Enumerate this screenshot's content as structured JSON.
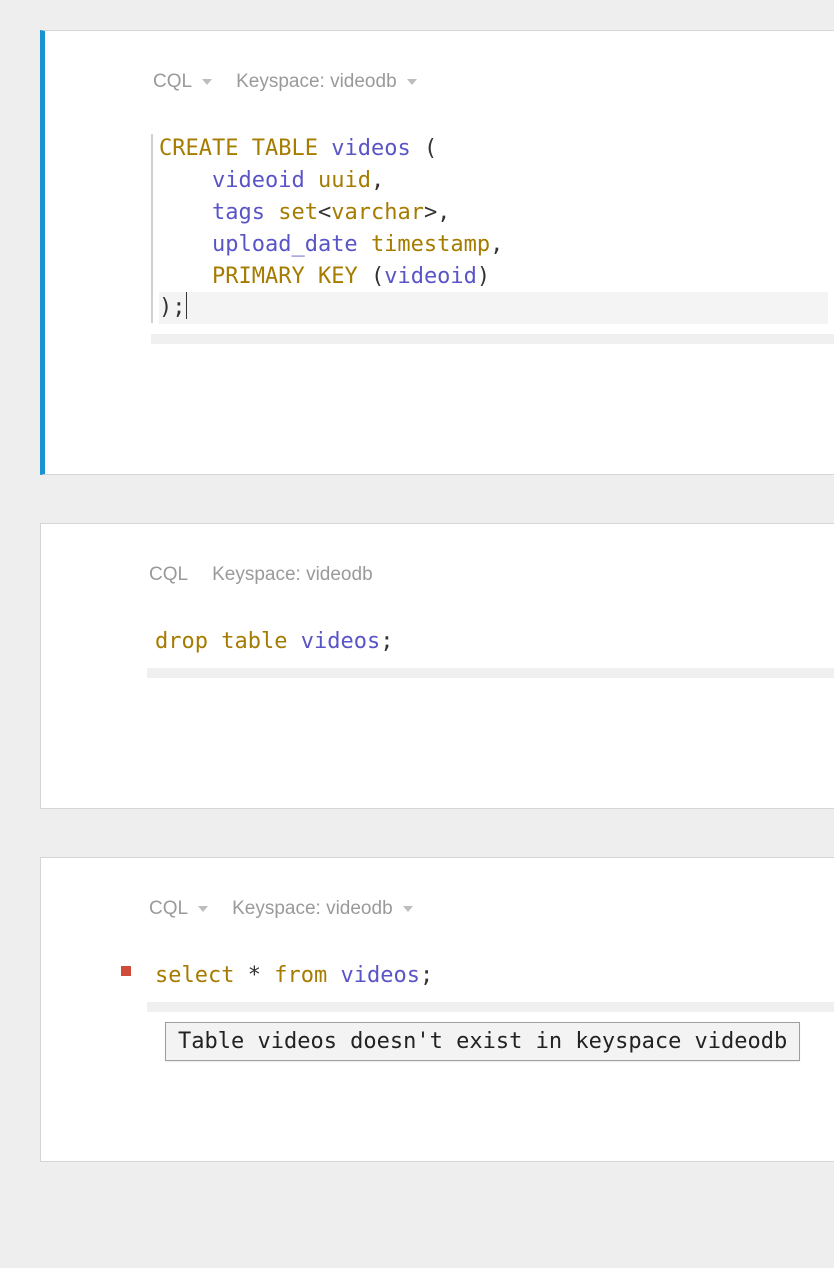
{
  "cells": [
    {
      "lang": "CQL",
      "keyspace_label": "Keyspace: videodb",
      "show_dropdowns": true,
      "selected": true,
      "bottom_space": "lg",
      "code_html": "<div class='line'><span class='kw'>CREATE</span> <span class='kw'>TABLE</span> <span class='id'>videos</span> <span class='pn'>(</span></div><div class='line'>    <span class='id'>videoid</span> <span class='ty'>uuid</span><span class='pn'>,</span></div><div class='line'>    <span class='id'>tags</span> <span class='ty'>set</span><span class='pn'>&lt;</span><span class='ty'>varchar</span><span class='pn'>&gt;,</span></div><div class='line'>    <span class='id'>upload_date</span> <span class='ty'>timestamp</span><span class='pn'>,</span></div><div class='line'>    <span class='kw'>PRIMARY</span> <span class='kw'>KEY</span> <span class='pn'>(</span><span class='id'>videoid</span><span class='pn'>)</span></div><div class='line hl'><span class='pn'>);</span><span class='cursor'></span></div>",
      "has_gutter": true
    },
    {
      "lang": "CQL",
      "keyspace_label": "Keyspace: videodb",
      "show_dropdowns": false,
      "selected": false,
      "bottom_space": "lg",
      "code_html": "<div class='line'><span class='kw'>drop</span> <span class='kw'>table</span> <span class='id'>videos</span><span class='pn'>;</span></div>",
      "has_gutter": false
    },
    {
      "lang": "CQL",
      "keyspace_label": "Keyspace: videodb",
      "show_dropdowns": true,
      "selected": false,
      "bottom_space": "sm",
      "code_html": "<div class='line'><span class='kw'>select</span> <span class='pn'>*</span> <span class='kw'>from</span> <span class='id'>videos</span><span class='pn'>;</span></div>",
      "has_gutter": false,
      "error": true,
      "tooltip": "Table videos doesn't exist in keyspace videodb"
    }
  ]
}
